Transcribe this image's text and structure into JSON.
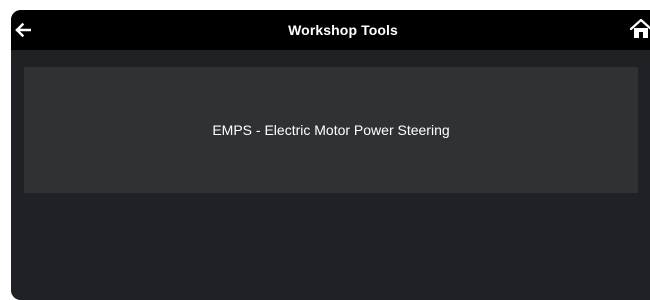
{
  "header": {
    "title": "Workshop Tools",
    "back_icon": "arrow-left-icon",
    "home_icon": "home-icon"
  },
  "tools": [
    {
      "label": "EMPS - Electric Motor Power Steering"
    }
  ],
  "colors": {
    "header_bg": "#000000",
    "screen_bg": "#202124",
    "item_bg": "#303133",
    "text": "#ffffff"
  }
}
